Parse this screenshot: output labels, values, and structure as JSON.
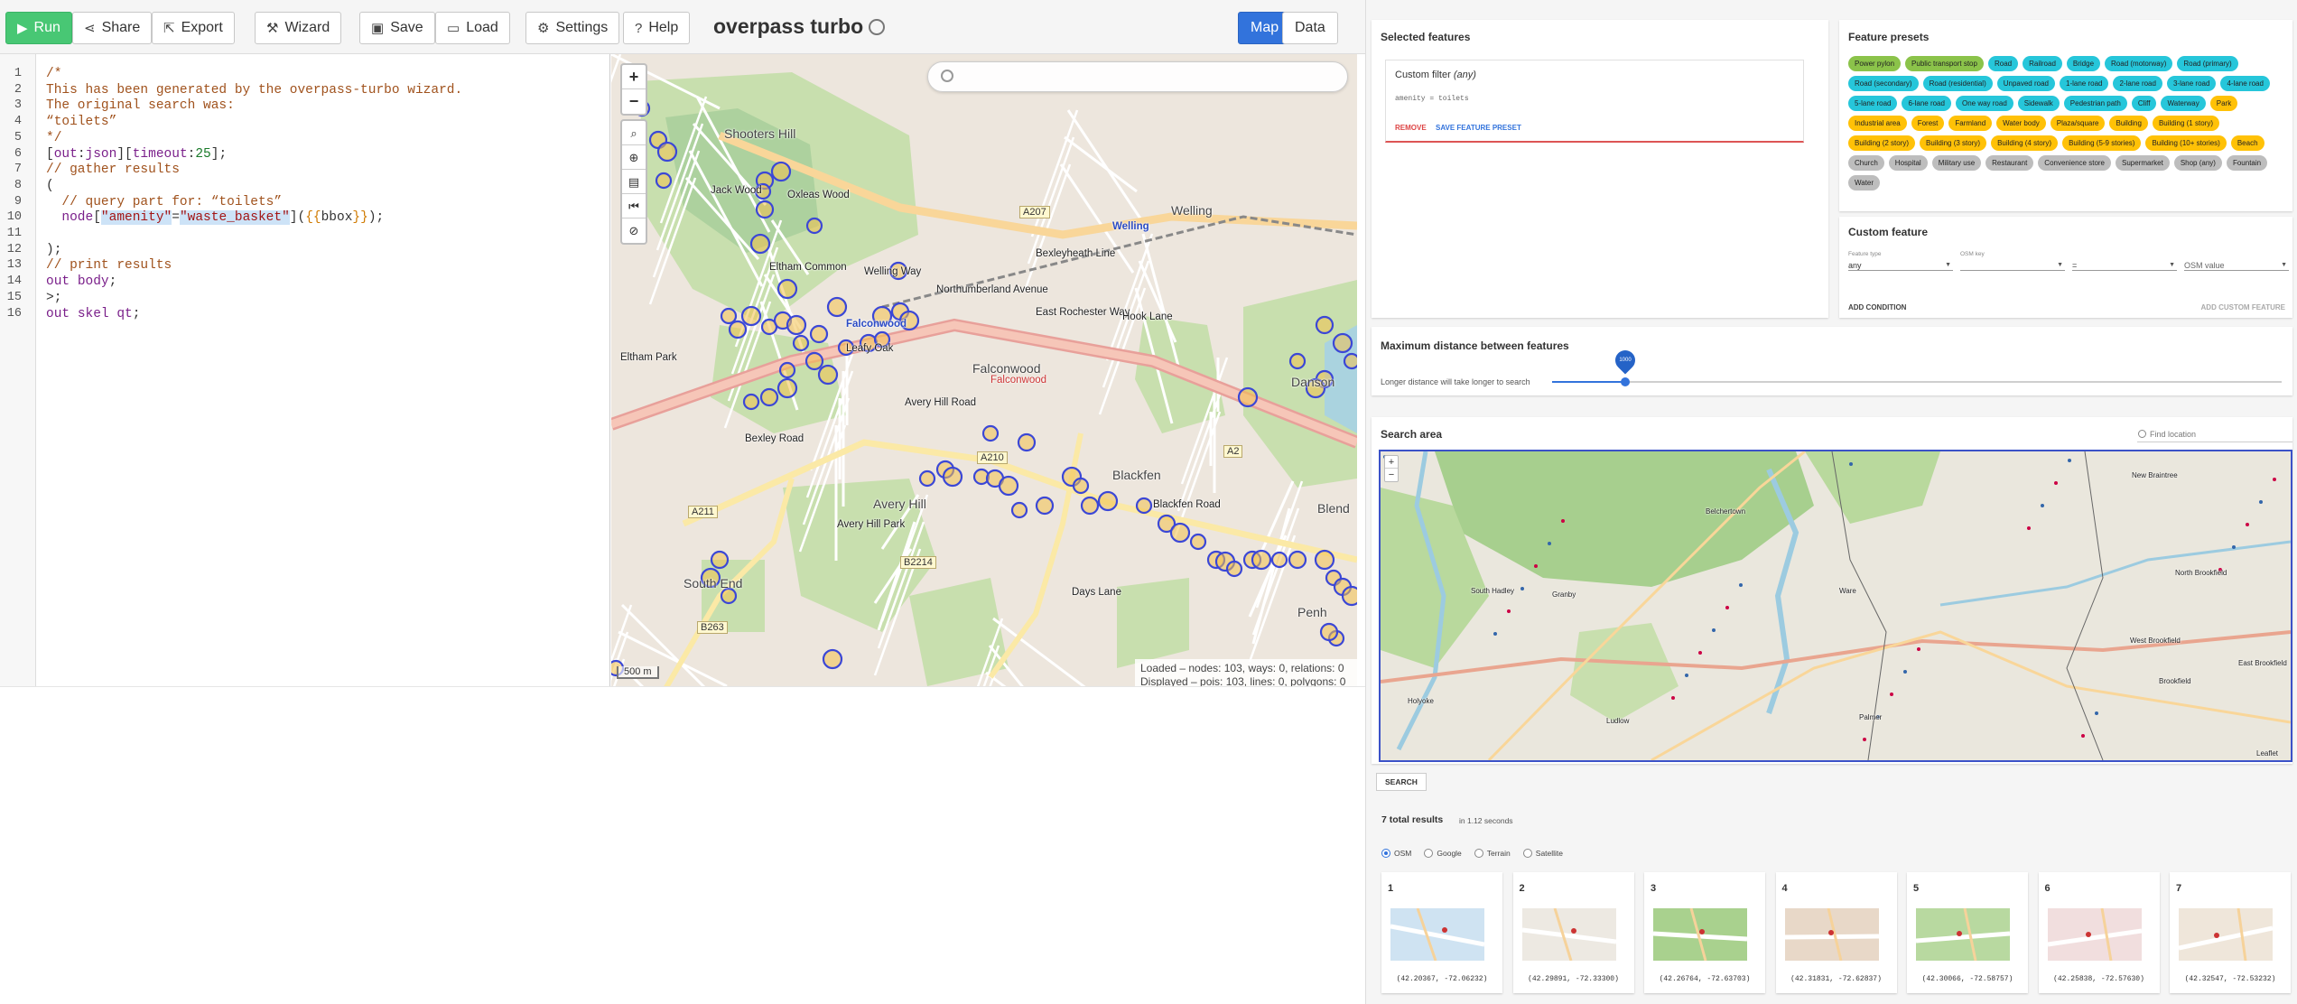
{
  "toolbar": {
    "run": "Run",
    "share": "Share",
    "export": "Export",
    "wizard": "Wizard",
    "save": "Save",
    "load": "Load",
    "settings": "Settings",
    "help": "Help",
    "app_title": "overpass turbo",
    "map_tab": "Map",
    "data_tab": "Data"
  },
  "editor": {
    "lines": [
      "/*",
      "This has been generated by the overpass-turbo wizard.",
      "The original search was:",
      "“toilets”",
      "*/",
      "[out:json][timeout:25];",
      "// gather results",
      "(",
      "  // query part for: “toilets”",
      "  node[\"amenity\"=\"waste_basket\"]({{bbox}});",
      "",
      ");",
      "// print results",
      "out body;",
      ">;",
      "out skel qt;"
    ]
  },
  "map": {
    "labels": {
      "shooters_hill": "Shooters Hill",
      "welling": "Welling",
      "welling_blue": "Welling",
      "falconwood_blue": "Falconwood",
      "falconwood": "Falconwood",
      "falconwood_red": "Falconwood",
      "eltham_park": "Eltham Park",
      "avery_hill": "Avery Hill",
      "avery_hill_park": "Avery Hill Park",
      "south_end": "South End",
      "blackfen": "Blackfen",
      "danson": "Danson",
      "bexley_road": "Bexley Road",
      "rochester_way": "East Rochester Way",
      "welling_way": "Welling Way",
      "bexleyheath_line": "Bexleyheath Line",
      "northumberland": "Northumberland Avenue",
      "hook_lane": "Hook Lane",
      "blackfen_road": "Blackfen Road",
      "penhill": "Penh",
      "blendon": "Blend",
      "avery_hill_road": "Avery Hill Road",
      "day_lane": "Days Lane",
      "jack_wood": "Jack Wood",
      "oxleas": "Oxleas Wood",
      "eltham_common": "Eltham Common",
      "leafy": "Leafy Oak"
    },
    "shields": {
      "a207": "A207",
      "a2": "A2",
      "a210": "A210",
      "a211": "A211",
      "b2214": "B2214",
      "b263": "B263"
    },
    "stats_line1": "Loaded – nodes: 103, ways: 0, relations: 0",
    "stats_line2": "Displayed – pois: 103, lines: 0, polygons: 0",
    "scale": "500 m",
    "zoom_in": "+",
    "zoom_out": "−"
  },
  "wizard": {
    "selected_title": "Selected features",
    "custom_filter_title": "Custom filter",
    "custom_filter_any": "(any)",
    "custom_filter_cond": "amenity = toilets",
    "remove": "REMOVE",
    "save_preset": "SAVE FEATURE PRESET",
    "presets_title": "Feature presets",
    "presets": [
      {
        "label": "Power pylon",
        "color": "#8bc34a"
      },
      {
        "label": "Public transport stop",
        "color": "#8bc34a"
      },
      {
        "label": "Road",
        "color": "#26c6da"
      },
      {
        "label": "Railroad",
        "color": "#26c6da"
      },
      {
        "label": "Bridge",
        "color": "#26c6da"
      },
      {
        "label": "Road (motorway)",
        "color": "#26c6da"
      },
      {
        "label": "Road (primary)",
        "color": "#26c6da"
      },
      {
        "label": "Road (secondary)",
        "color": "#26c6da"
      },
      {
        "label": "Road (residential)",
        "color": "#26c6da"
      },
      {
        "label": "Unpaved road",
        "color": "#26c6da"
      },
      {
        "label": "1-lane road",
        "color": "#26c6da"
      },
      {
        "label": "2-lane road",
        "color": "#26c6da"
      },
      {
        "label": "3-lane road",
        "color": "#26c6da"
      },
      {
        "label": "4-lane road",
        "color": "#26c6da"
      },
      {
        "label": "5-lane road",
        "color": "#26c6da"
      },
      {
        "label": "6-lane road",
        "color": "#26c6da"
      },
      {
        "label": "One way road",
        "color": "#26c6da"
      },
      {
        "label": "Sidewalk",
        "color": "#26c6da"
      },
      {
        "label": "Pedestrian path",
        "color": "#26c6da"
      },
      {
        "label": "Cliff",
        "color": "#26c6da"
      },
      {
        "label": "Waterway",
        "color": "#26c6da"
      },
      {
        "label": "Park",
        "color": "#ffc107"
      },
      {
        "label": "Industrial area",
        "color": "#ffc107"
      },
      {
        "label": "Forest",
        "color": "#ffc107"
      },
      {
        "label": "Farmland",
        "color": "#ffc107"
      },
      {
        "label": "Water body",
        "color": "#ffc107"
      },
      {
        "label": "Plaza/square",
        "color": "#ffc107"
      },
      {
        "label": "Building",
        "color": "#ffc107"
      },
      {
        "label": "Building (1 story)",
        "color": "#ffc107"
      },
      {
        "label": "Building (2 story)",
        "color": "#ffc107"
      },
      {
        "label": "Building (3 story)",
        "color": "#ffc107"
      },
      {
        "label": "Building (4 story)",
        "color": "#ffc107"
      },
      {
        "label": "Building (5-9 stories)",
        "color": "#ffc107"
      },
      {
        "label": "Building (10+ stories)",
        "color": "#ffc107"
      },
      {
        "label": "Beach",
        "color": "#ffc107"
      },
      {
        "label": "Church",
        "color": "#bdbdbd"
      },
      {
        "label": "Hospital",
        "color": "#bdbdbd"
      },
      {
        "label": "Military use",
        "color": "#bdbdbd"
      },
      {
        "label": "Restaurant",
        "color": "#bdbdbd"
      },
      {
        "label": "Convenience store",
        "color": "#bdbdbd"
      },
      {
        "label": "Supermarket",
        "color": "#bdbdbd"
      },
      {
        "label": "Shop (any)",
        "color": "#bdbdbd"
      },
      {
        "label": "Fountain",
        "color": "#bdbdbd"
      },
      {
        "label": "Water",
        "color": "#bdbdbd"
      }
    ],
    "custom_feature_title": "Custom feature",
    "feature_type_cap": "Feature type",
    "feature_type_val": "any",
    "osm_key_cap": "OSM key",
    "op_val": "=",
    "osm_value_placeholder": "OSM value",
    "add_condition": "ADD CONDITION",
    "add_custom": "ADD CUSTOM FEATURE",
    "distance_title": "Maximum distance between features",
    "distance_sub": "Longer distance will take longer to search",
    "distance_value": 0.1,
    "distance_bubble": "1000",
    "area_title": "Search area",
    "find_location": "Find location",
    "area_map": {
      "labels": {
        "belchertown": "Belchertown",
        "granby": "Granby",
        "ware": "Ware",
        "holyoke": "Holyoke",
        "south_hadley": "South Hadley",
        "new_braintree": "New Braintree",
        "north_brookfield": "North Brookfield",
        "west_brookfield": "West Brookfield",
        "brookfield": "Brookfield",
        "east_brookfield": "East Brookfield",
        "palmer": "Palmer",
        "ludlow": "Ludlow",
        "leaflet": "Leaflet"
      },
      "zoom_in": "+",
      "zoom_out": "−"
    },
    "search_btn": "SEARCH",
    "results_count": "7 total results",
    "results_time": "in 1.12 seconds",
    "radios": [
      {
        "label": "OSM",
        "on": true
      },
      {
        "label": "Google",
        "on": false
      },
      {
        "label": "Terrain",
        "on": false
      },
      {
        "label": "Satellite",
        "on": false
      }
    ],
    "results": [
      {
        "num": "1",
        "coord": "(42.20367, -72.06232)"
      },
      {
        "num": "2",
        "coord": "(42.29891, -72.33300)"
      },
      {
        "num": "3",
        "coord": "(42.26764, -72.63703)"
      },
      {
        "num": "4",
        "coord": "(42.31831, -72.62837)"
      },
      {
        "num": "5",
        "coord": "(42.30066, -72.58757)"
      },
      {
        "num": "6",
        "coord": "(42.25838, -72.57630)"
      },
      {
        "num": "7",
        "coord": "(42.32547, -72.53232)"
      }
    ]
  },
  "colors": {
    "run_green": "#48c774",
    "accent_blue": "#3273dc",
    "poi_blue": "#3b47d6",
    "poi_fill": "#f2c14e",
    "remove_red": "#dd4444"
  }
}
